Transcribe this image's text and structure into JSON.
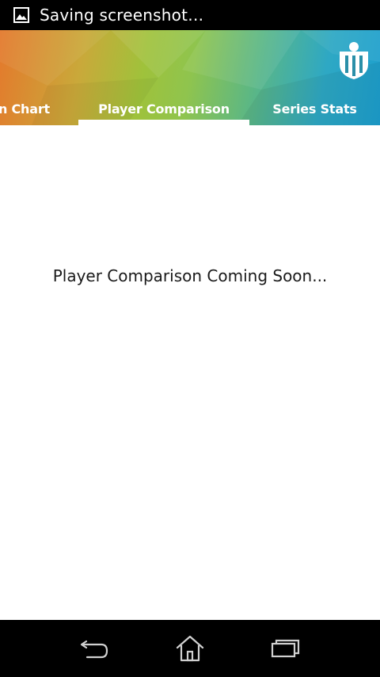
{
  "status_bar": {
    "notification_icon": "image-icon",
    "notification_text": "Saving screenshot…"
  },
  "header": {
    "logo_icon": "team-crest-icon",
    "colors": {
      "gradient_start": "#e4792c",
      "gradient_mid": "#9fc23b",
      "gradient_end": "#1c9fce",
      "tab_text": "#ffffff",
      "indicator": "#ffffff"
    },
    "tabs": [
      {
        "label": "Scan Chart",
        "selected": false
      },
      {
        "label": "Player Comparison",
        "selected": true
      },
      {
        "label": "Series Stats",
        "selected": false
      }
    ]
  },
  "content": {
    "message": "Player Comparison Coming Soon..."
  },
  "nav_bar": {
    "back_icon": "back-arrow-icon",
    "home_icon": "home-icon",
    "recents_icon": "recent-apps-icon"
  }
}
